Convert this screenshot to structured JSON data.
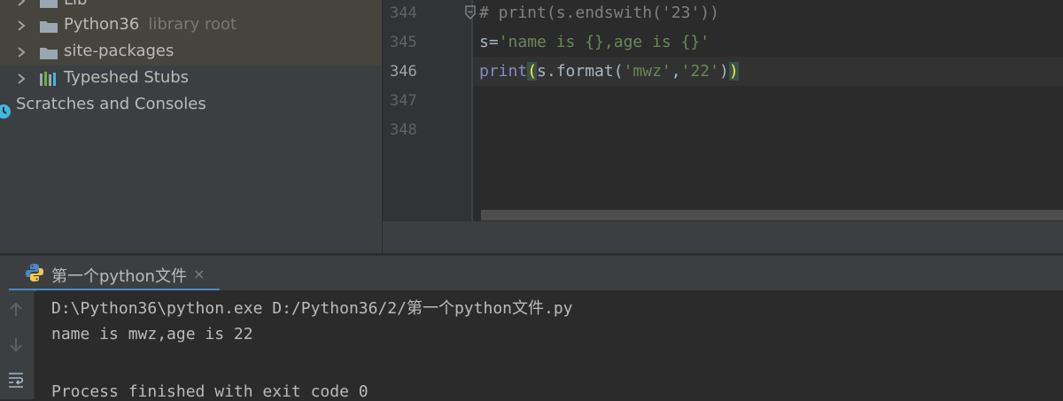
{
  "project_tree": {
    "items": [
      {
        "label": "Lib",
        "hint": ""
      },
      {
        "label": "Python36",
        "hint": "library root"
      },
      {
        "label": "site-packages",
        "hint": ""
      },
      {
        "label": "Typeshed Stubs",
        "hint": ""
      },
      {
        "label": "Scratches and Consoles",
        "hint": ""
      }
    ]
  },
  "editor": {
    "line_numbers": [
      "344",
      "345",
      "346",
      "347",
      "348"
    ],
    "lines": {
      "l344": "# print(s.endswith('23'))",
      "l345_var": "s=",
      "l345_str": "'name is {},age is {}'",
      "l346_print": "print",
      "l346_open": "(",
      "l346_mid": "s.format(",
      "l346_arg1": "'mwz'",
      "l346_comma": ",",
      "l346_arg2": "'22'",
      "l346_close_inner": ")",
      "l346_close": ")"
    }
  },
  "run": {
    "tab_label": "第一个python文件",
    "close_glyph": "×",
    "console": [
      "D:\\Python36\\python.exe D:/Python36/2/第一个python文件.py",
      "name is mwz,age is 22",
      "",
      "Process finished with exit code 0"
    ]
  },
  "colors": {
    "accent": "#4a88c7",
    "string": "#6a8759",
    "comment": "#808080",
    "builtin": "#8888c6"
  }
}
